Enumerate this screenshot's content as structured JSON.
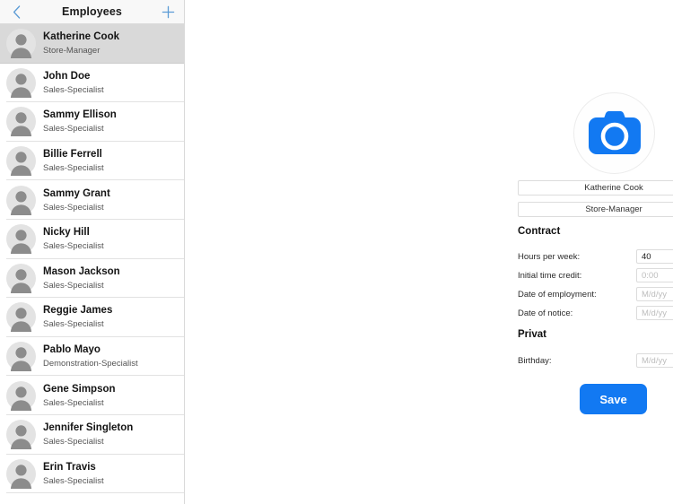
{
  "sidebar": {
    "title": "Employees",
    "back_icon": "chevron-left-icon",
    "add_icon": "plus-icon",
    "employees": [
      {
        "name": "Katherine Cook",
        "role": "Store-Manager",
        "selected": true
      },
      {
        "name": "John Doe",
        "role": "Sales-Specialist",
        "selected": false
      },
      {
        "name": "Sammy Ellison",
        "role": "Sales-Specialist",
        "selected": false
      },
      {
        "name": "Billie Ferrell",
        "role": "Sales-Specialist",
        "selected": false
      },
      {
        "name": "Sammy Grant",
        "role": "Sales-Specialist",
        "selected": false
      },
      {
        "name": "Nicky Hill",
        "role": "Sales-Specialist",
        "selected": false
      },
      {
        "name": "Mason Jackson",
        "role": "Sales-Specialist",
        "selected": false
      },
      {
        "name": "Reggie James",
        "role": "Sales-Specialist",
        "selected": false
      },
      {
        "name": "Pablo Mayo",
        "role": "Demonstration-Specialist",
        "selected": false
      },
      {
        "name": "Gene Simpson",
        "role": "Sales-Specialist",
        "selected": false
      },
      {
        "name": "Jennifer Singleton",
        "role": "Sales-Specialist",
        "selected": false
      },
      {
        "name": "Erin Travis",
        "role": "Sales-Specialist",
        "selected": false
      }
    ]
  },
  "detail": {
    "photo_icon": "camera-icon",
    "name_value": "Katherine Cook",
    "role_value": "Store-Manager",
    "contract": {
      "heading": "Contract",
      "fields": [
        {
          "label": "Hours per week:",
          "value": "40",
          "placeholder": "",
          "is_placeholder": false
        },
        {
          "label": "Initial time credit:",
          "value": "0:00",
          "placeholder": "0:00",
          "is_placeholder": true
        },
        {
          "label": "Date of employment:",
          "value": "M/d/yy",
          "placeholder": "M/d/yy",
          "is_placeholder": true
        },
        {
          "label": "Date of notice:",
          "value": "M/d/yy",
          "placeholder": "M/d/yy",
          "is_placeholder": true
        }
      ]
    },
    "privat": {
      "heading": "Privat",
      "fields": [
        {
          "label": "Birthday:",
          "value": "M/d/yy",
          "placeholder": "M/d/yy",
          "is_placeholder": true
        }
      ]
    },
    "save_label": "Save"
  },
  "colors": {
    "accent_blue": "#1279f2",
    "selected_row": "#d9d9d9",
    "avatar_gray": "#8c8c8c",
    "placeholder_gray": "#bdbdbd"
  }
}
